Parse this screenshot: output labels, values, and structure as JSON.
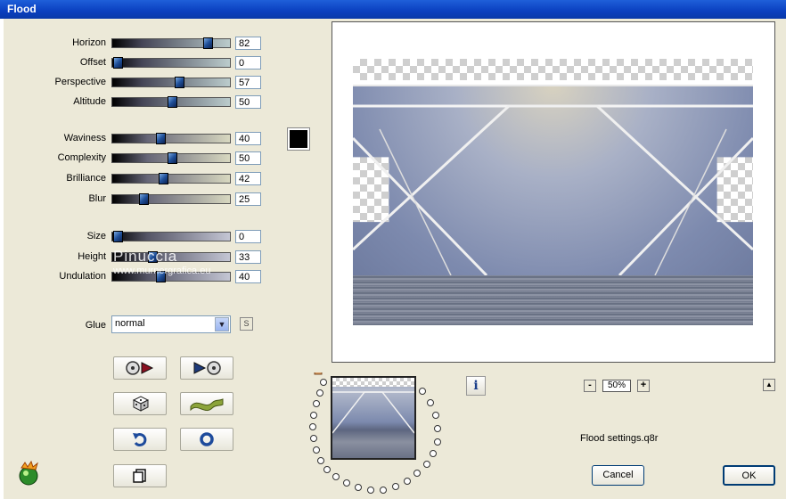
{
  "window": {
    "title": "Flood"
  },
  "params_group1": [
    {
      "label": "Horizon",
      "value": "82",
      "gradient": "g1"
    },
    {
      "label": "Offset",
      "value": "0",
      "gradient": "g1"
    },
    {
      "label": "Perspective",
      "value": "57",
      "gradient": "g1"
    },
    {
      "label": "Altitude",
      "value": "50",
      "gradient": "g1"
    }
  ],
  "params_group2": [
    {
      "label": "Waviness",
      "value": "40",
      "gradient": "g2"
    },
    {
      "label": "Complexity",
      "value": "50",
      "gradient": "g2"
    },
    {
      "label": "Brilliance",
      "value": "42",
      "gradient": "g2"
    },
    {
      "label": "Blur",
      "value": "25",
      "gradient": "g2"
    }
  ],
  "params_group3": [
    {
      "label": "Size",
      "value": "0",
      "gradient": "g3"
    },
    {
      "label": "Height",
      "value": "33",
      "gradient": "g3"
    },
    {
      "label": "Undulation",
      "value": "40",
      "gradient": "g3"
    }
  ],
  "color_swatch": "#000000",
  "glue": {
    "label": "Glue",
    "value": "normal",
    "s_button": "S"
  },
  "watermark": {
    "line1": "Pinuccia",
    "line2": "www.murnergrafica.eu"
  },
  "icons": [
    "prev-preset-icon",
    "next-preset-icon",
    "random-dice-icon",
    "wave-icon",
    "reset-undo-icon",
    "circle-icon",
    "copy-page-icon",
    "app-logo-icon",
    "info-icon"
  ],
  "zoom": {
    "minus": "-",
    "value": "50%",
    "plus": "+",
    "up": "▲"
  },
  "settings_file": "Flood settings.q8r",
  "buttons": {
    "cancel": "Cancel",
    "ok": "OK"
  }
}
